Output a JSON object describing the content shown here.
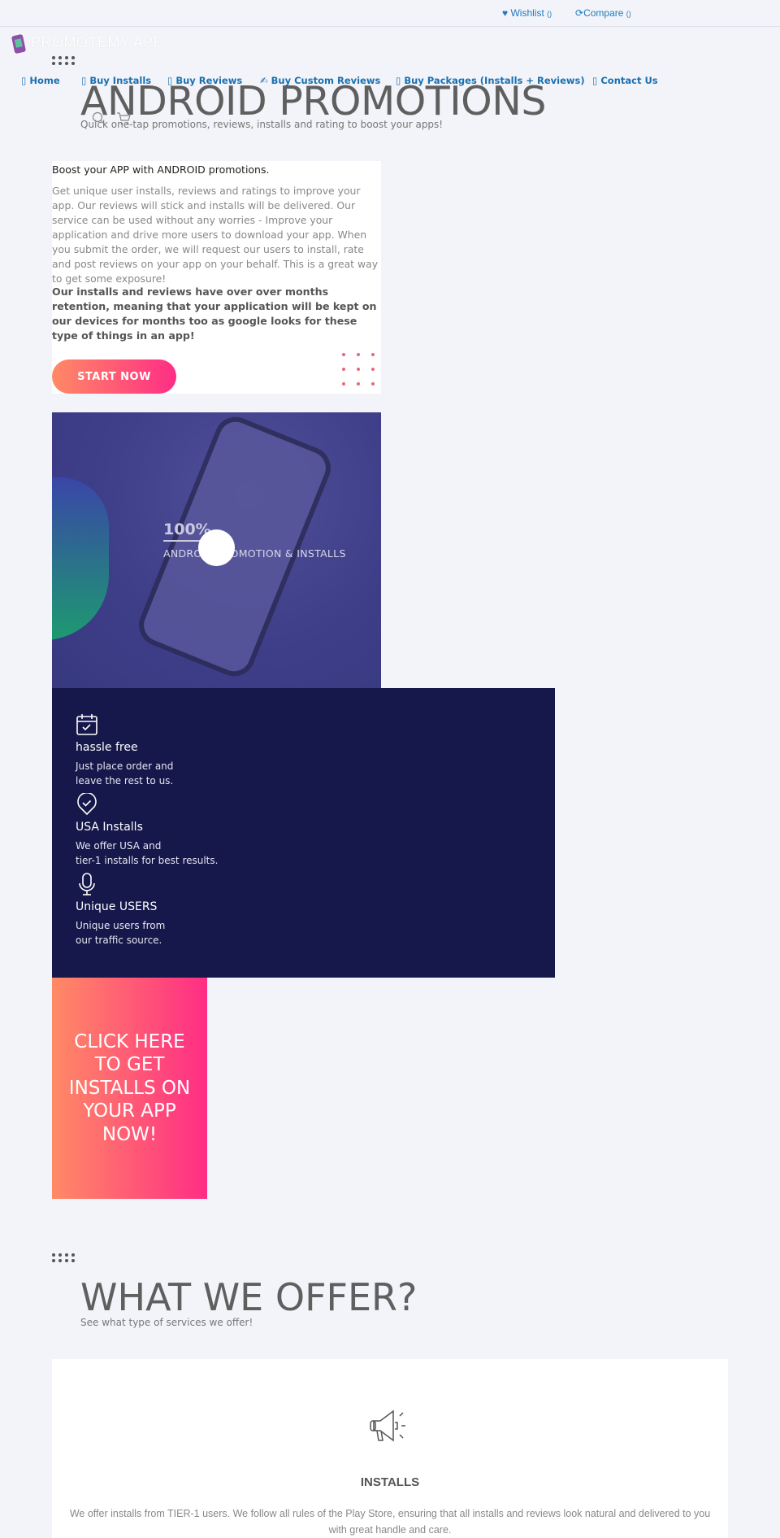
{
  "topbar": {
    "wishlist_label": "Wishlist",
    "wishlist_count": "()",
    "compare_label": "Compare",
    "compare_count": "()"
  },
  "brand": {
    "logo_text": "PROMOTEMY.APP"
  },
  "nav": {
    "items": [
      {
        "label": "Home",
        "icon": "▯"
      },
      {
        "label": "Buy Installs",
        "icon": "▯"
      },
      {
        "label": "Buy Reviews",
        "icon": "▯"
      },
      {
        "label": "Buy Custom Reviews",
        "icon": "✍"
      },
      {
        "label": "Buy Packages (Installs + Reviews)",
        "icon": "▯"
      },
      {
        "label": "Contact Us",
        "icon": "▯"
      }
    ]
  },
  "hero": {
    "title": "ANDROID PROMOTIONS",
    "subtitle": "Quick one-tap promotions, reviews, installs and rating to boost your apps!"
  },
  "intro": {
    "lead": "Boost your APP with ANDROID promotions.",
    "paragraph": "Get unique user installs, reviews and ratings to improve your app. Our reviews will stick and installs will be delivered. Our service can be used without any worries - Improve your application and drive more users to download your app. When you submit the order, we will request our users to install, rate and post reviews on your app on your behalf. This is a great way to get some exposure!",
    "bold": "Our installs and reviews have over over months retention, meaning that your application will be kept on our devices for months too as google looks for these type of things in an app!",
    "button": "START NOW"
  },
  "stat": {
    "value": "100%",
    "caption": "ANDROID PROMOTION & INSTALLS"
  },
  "features": [
    {
      "icon": "calendar-check-icon",
      "title": "hassle free",
      "line1": "Just place order and",
      "line2": "leave the rest to us."
    },
    {
      "icon": "location-check-icon",
      "title": "USA Installs",
      "line1": "We offer USA and",
      "line2": "tier-1 installs for best results."
    },
    {
      "icon": "microphone-icon",
      "title": "Unique USERS",
      "line1": "Unique users from",
      "line2": "our traffic source."
    }
  ],
  "cta": {
    "label": "CLICK HERE TO GET INSTALLS ON YOUR APP NOW!"
  },
  "offer": {
    "title": "WHAT WE OFFER?",
    "subtitle": "See what type of services we offer!",
    "card": {
      "icon": "megaphone-icon",
      "title": "INSTALLS",
      "description": "We offer installs from TIER-1 users. We follow all rules of the Play Store, ensuring that all installs and reviews look natural and delivered to you with great handle and care."
    }
  },
  "colors": {
    "accent": "#1a6fb0",
    "dark": "#16174a",
    "gradient_start": "#ff8a65",
    "gradient_end": "#ff2d85"
  }
}
